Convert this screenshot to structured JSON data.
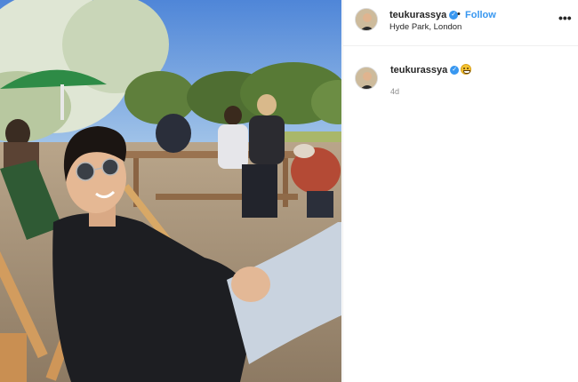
{
  "post": {
    "photo_alt": "",
    "header": {
      "username": "teukurassya",
      "verified_icon": "verified-badge-icon",
      "follow_label": "Follow",
      "location": "Hyde Park, London",
      "more_icon": "more-options-icon",
      "more_glyph": "•••"
    },
    "caption": {
      "username": "teukurassya",
      "emoji": "grinning-face-emoji",
      "timestamp": "4d"
    }
  },
  "colors": {
    "link_blue": "#3897f0",
    "verified_blue": "#3897f0",
    "divider": "#efefef",
    "muted_text": "#8e8e8e"
  }
}
